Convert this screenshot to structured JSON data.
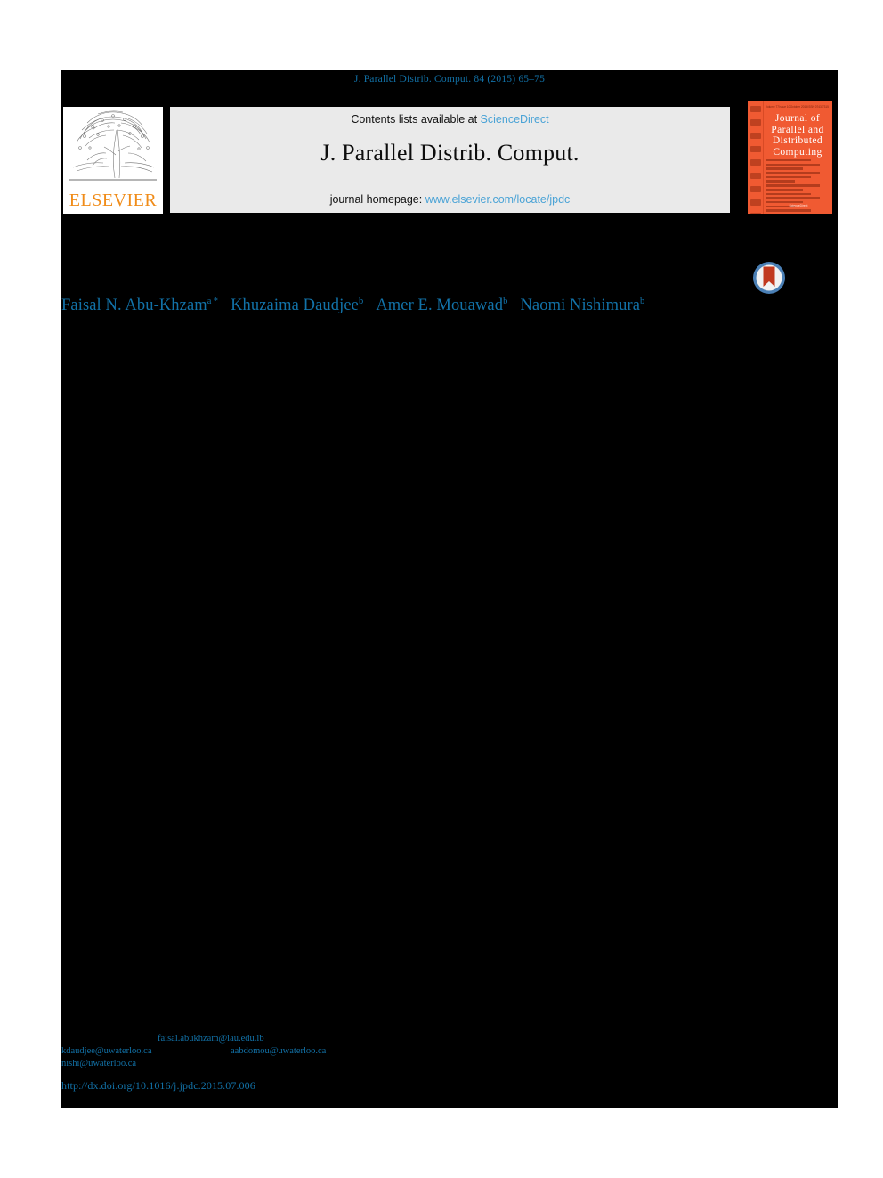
{
  "running_head": "J. Parallel Distrib. Comput. 84 (2015) 65–75",
  "banner": {
    "contents_prefix": "Contents lists available at ",
    "contents_link": "ScienceDirect",
    "journal_title": "J. Parallel Distrib. Comput.",
    "homepage_prefix": "journal homepage: ",
    "homepage_link": "www.elsevier.com/locate/jpdc"
  },
  "publisher_logo": {
    "wordmark": "ELSEVIER",
    "icon": "elsevier-tree-icon",
    "color": "#f08c19"
  },
  "journal_cover": {
    "title_line_1": "Journal of",
    "title_line_2": "Parallel and",
    "title_line_3": "Distributed",
    "title_line_4": "Computing",
    "top_left": "Volume 77",
    "top_mid": "Issue 10",
    "top_right": "October 2015",
    "top_far_right": "ISSN 0743-7315",
    "footer": "ScienceDirect",
    "background_color": "#f05a32"
  },
  "crossmark": {
    "label": "crossmark-badge",
    "ring_color": "#4a7fb5",
    "mark_color": "#c1391f"
  },
  "authors": [
    {
      "name": "Faisal N. Abu-Khzam",
      "marks": "a *"
    },
    {
      "name": "Khuzaima Daudjee",
      "marks": "b"
    },
    {
      "name": "Amer E. Mouawad",
      "marks": "b"
    },
    {
      "name": "Naomi Nishimura",
      "marks": "b"
    }
  ],
  "footnotes": {
    "email_1": "faisal.abukhzam@lau.edu.lb",
    "email_2": "kdaudjee@uwaterloo.ca",
    "email_3": "aabdomou@uwaterloo.ca",
    "email_4": "nishi@uwaterloo.ca",
    "doi": "http://dx.doi.org/10.1016/j.jpdc.2015.07.006"
  },
  "colors": {
    "link_blue": "#1272a8",
    "banner_grey": "#eaeaea",
    "science_direct_blue": "#4aa3d6",
    "page_body": "#000000"
  }
}
